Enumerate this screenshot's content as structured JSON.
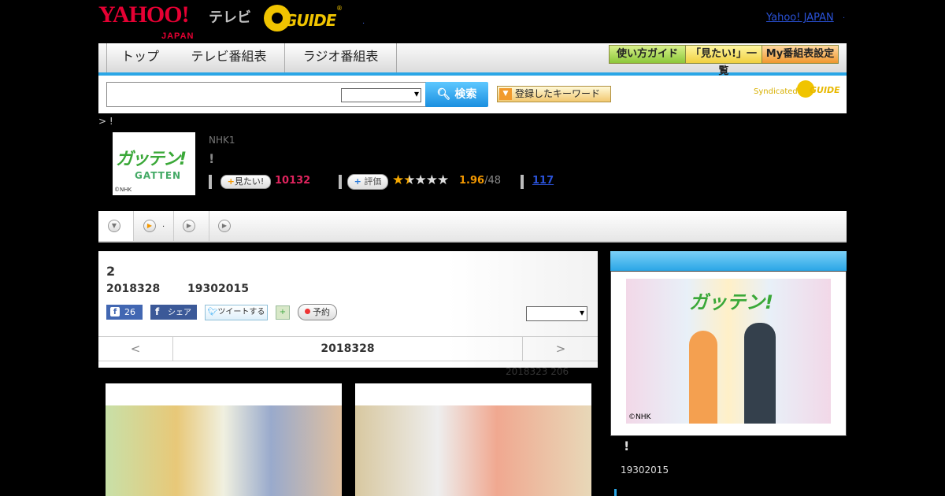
{
  "header": {
    "yahoo_logo": "YAHOO!",
    "yahoo_sub": "JAPAN",
    "tv_label": "テレビ",
    "gguide_logo": "GUIDE",
    "gguide_reg": "®",
    "dot": ".",
    "yahoo_japan_link": "Yahoo! JAPAN",
    "dot2": "."
  },
  "nav": {
    "tabs": [
      "トップ",
      "テレビ番組表",
      "ラジオ番組表"
    ],
    "guide_buttons": [
      "使い方ガイド",
      "「見たい!」一覧",
      "My番組表設定"
    ]
  },
  "search": {
    "input_value": "",
    "select_value": "",
    "button_label": "検索",
    "keyword_button": "登録したキーワード",
    "syndicated": "Syndicated",
    "syndicated_logo": "GUIDE"
  },
  "breadcrumb": "> !",
  "program": {
    "thumb_text": "ガッテン!",
    "thumb_sub": "GATTEN",
    "thumb_copy": "©NHK",
    "channel": "NHK1",
    "title": "!",
    "mitai_label": "見たい!",
    "mitai_count": "10132",
    "hyoka_label": "評価",
    "rating_value": 1.96,
    "rating_display": "1.96",
    "rating_total": "/48",
    "review_count": "117"
  },
  "filter_tabs": [
    {
      "label": ""
    },
    {
      "label": "."
    },
    {
      "label": ""
    },
    {
      "label": ""
    }
  ],
  "episode": {
    "title": "2",
    "date": "2018328",
    "time": "19302015",
    "fb_count": "26",
    "share_label": "シェア",
    "tweet_label": "ツイートする",
    "yoyaku_label": "予約",
    "select_value": "",
    "pager_prev": "<",
    "pager_date": "2018328",
    "pager_next": ">",
    "updated": "2018323  206"
  },
  "right_panel": {
    "image_title": "ガッテン!",
    "image_copy": "©NHK",
    "title": "!",
    "time": "19302015"
  },
  "colors": {
    "accent_blue": "#2aa6e6",
    "mitai_red": "#e0245e",
    "rating_orange": "#f39800",
    "link_blue": "#2a52d8"
  }
}
